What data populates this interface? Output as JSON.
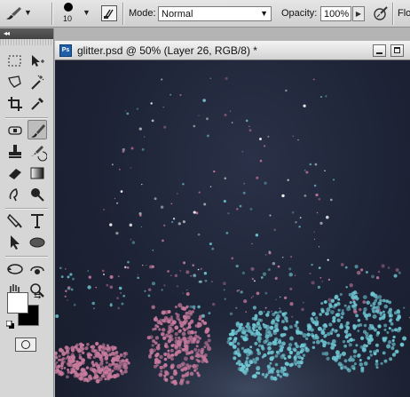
{
  "options_bar": {
    "brush_size": "10",
    "mode_label": "Mode:",
    "mode_value": "Normal",
    "opacity_label": "Opacity:",
    "opacity_value": "100%",
    "flow_label_partial": "Flo"
  },
  "document": {
    "title": "glitter.psd @ 50% (Layer 26, RGB/8) *",
    "app_badge": "Ps"
  },
  "toolbox": {
    "collapse_glyph": "◂◂",
    "active_tool": "brush-tool",
    "foreground_color": "#ffffff",
    "background_color": "#000000"
  },
  "colors": {
    "canvas_background": "#1f2436",
    "glitter_pink": "#c77a9c",
    "glitter_cyan": "#6fc7d3"
  }
}
